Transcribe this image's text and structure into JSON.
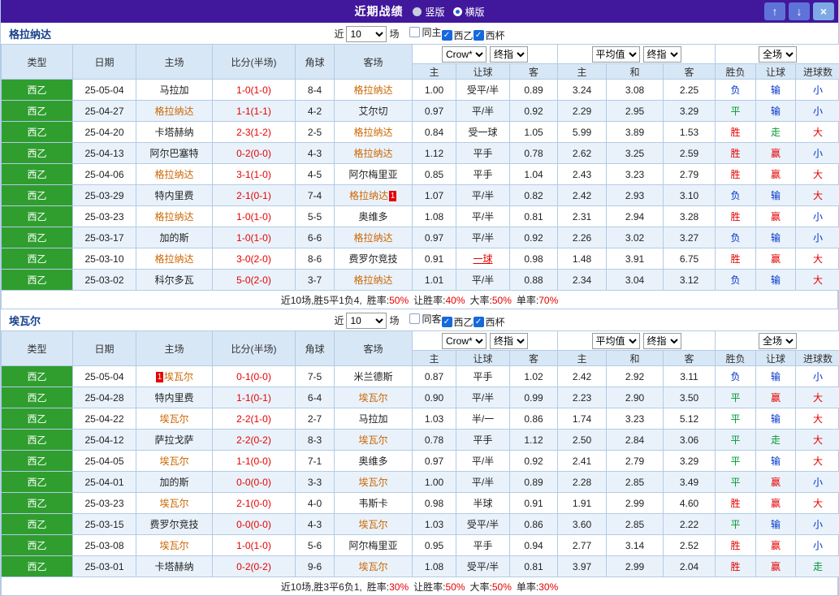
{
  "titlebar": {
    "title": "近期战绩",
    "layout_options": [
      {
        "label": "竖版",
        "selected": false
      },
      {
        "label": "横版",
        "selected": true
      }
    ],
    "up_icon": "↑",
    "down_icon": "↓",
    "close_icon": "×"
  },
  "table_headers": {
    "main": [
      "类型",
      "日期",
      "主场",
      "比分(半场)",
      "角球",
      "客场"
    ],
    "sub": [
      "主",
      "让球",
      "客",
      "主",
      "和",
      "客",
      "胜负",
      "让球",
      "进球数"
    ]
  },
  "colors": {
    "win_red": "#e60000",
    "draw_green": "#009933",
    "loss_blue": "#0033cc",
    "team_highlight": "#cc6600",
    "titlebar_purple": "#41189b",
    "league_green": "#2f9e2f",
    "header_blue": "#d8e7f6"
  },
  "sections": [
    {
      "team": "格拉纳达",
      "filter": {
        "prefix": "近",
        "count": "10",
        "suffix": "场",
        "checkboxes": [
          {
            "label": "同主",
            "checked": false
          },
          {
            "label": "西乙",
            "checked": true
          },
          {
            "label": "西杯",
            "checked": true
          }
        ]
      },
      "selects": {
        "odds_company": "Crow*",
        "odds_stage": "终指",
        "avg_source": "平均值",
        "avg_stage": "终指",
        "scope": "全场"
      },
      "rows": [
        {
          "league": "西乙",
          "date": "25-05-04",
          "home": "马拉加",
          "score": "1-0(1-0)",
          "corners": "8-4",
          "away": "格拉纳达",
          "handicap": [
            "1.00",
            "受平/半",
            "0.89"
          ],
          "average": [
            "3.24",
            "3.08",
            "2.25"
          ],
          "outcome": "负",
          "handicap_result": "输",
          "goals": "小"
        },
        {
          "league": "西乙",
          "date": "25-04-27",
          "home": "格拉纳达",
          "score": "1-1(1-1)",
          "corners": "4-2",
          "away": "艾尔切",
          "handicap": [
            "0.97",
            "平/半",
            "0.92"
          ],
          "average": [
            "2.29",
            "2.95",
            "3.29"
          ],
          "outcome": "平",
          "handicap_result": "输",
          "goals": "小"
        },
        {
          "league": "西乙",
          "date": "25-04-20",
          "home": "卡塔赫纳",
          "score": "2-3(1-2)",
          "corners": "2-5",
          "away": "格拉纳达",
          "handicap": [
            "0.84",
            "受一球",
            "1.05"
          ],
          "average": [
            "5.99",
            "3.89",
            "1.53"
          ],
          "outcome": "胜",
          "handicap_result": "走",
          "goals": "大"
        },
        {
          "league": "西乙",
          "date": "25-04-13",
          "home": "阿尔巴塞特",
          "score": "0-2(0-0)",
          "corners": "4-3",
          "away": "格拉纳达",
          "handicap": [
            "1.12",
            "平手",
            "0.78"
          ],
          "average": [
            "2.62",
            "3.25",
            "2.59"
          ],
          "outcome": "胜",
          "handicap_result": "赢",
          "goals": "小"
        },
        {
          "league": "西乙",
          "date": "25-04-06",
          "home": "格拉纳达",
          "score": "3-1(1-0)",
          "corners": "4-5",
          "away": "阿尔梅里亚",
          "handicap": [
            "0.85",
            "平手",
            "1.04"
          ],
          "average": [
            "2.43",
            "3.23",
            "2.79"
          ],
          "outcome": "胜",
          "handicap_result": "赢",
          "goals": "大"
        },
        {
          "league": "西乙",
          "date": "25-03-29",
          "home": "特内里费",
          "score": "2-1(0-1)",
          "corners": "7-4",
          "away": "格拉纳达",
          "away_badge": "1",
          "away_badge_pos": "after",
          "handicap": [
            "1.07",
            "平/半",
            "0.82"
          ],
          "average": [
            "2.42",
            "2.93",
            "3.10"
          ],
          "outcome": "负",
          "handicap_result": "输",
          "goals": "大"
        },
        {
          "league": "西乙",
          "date": "25-03-23",
          "home": "格拉纳达",
          "score": "1-0(1-0)",
          "corners": "5-5",
          "away": "奥维多",
          "handicap": [
            "1.08",
            "平/半",
            "0.81"
          ],
          "average": [
            "2.31",
            "2.94",
            "3.28"
          ],
          "outcome": "胜",
          "handicap_result": "赢",
          "goals": "小"
        },
        {
          "league": "西乙",
          "date": "25-03-17",
          "home": "加的斯",
          "score": "1-0(1-0)",
          "corners": "6-6",
          "away": "格拉纳达",
          "handicap": [
            "0.97",
            "平/半",
            "0.92"
          ],
          "average": [
            "2.26",
            "3.02",
            "3.27"
          ],
          "outcome": "负",
          "handicap_result": "输",
          "goals": "小"
        },
        {
          "league": "西乙",
          "date": "25-03-10",
          "home": "格拉纳达",
          "score": "3-0(2-0)",
          "corners": "8-6",
          "away": "费罗尔竞技",
          "handicap": [
            "0.91",
            "一球",
            "0.98"
          ],
          "handicap_red": true,
          "average": [
            "1.48",
            "3.91",
            "6.75"
          ],
          "outcome": "胜",
          "handicap_result": "赢",
          "goals": "大"
        },
        {
          "league": "西乙",
          "date": "25-03-02",
          "home": "科尔多瓦",
          "score": "5-0(2-0)",
          "corners": "3-7",
          "away": "格拉纳达",
          "handicap": [
            "1.01",
            "平/半",
            "0.88"
          ],
          "average": [
            "2.34",
            "3.04",
            "3.12"
          ],
          "outcome": "负",
          "handicap_result": "输",
          "goals": "大"
        }
      ],
      "summary": {
        "prefix": "近10场,胜5平1负4,",
        "stats": [
          {
            "label": "胜率:",
            "value": "50%"
          },
          {
            "label": "让胜率:",
            "value": "40%"
          },
          {
            "label": "大率:",
            "value": "50%"
          },
          {
            "label": "单率:",
            "value": "70%"
          }
        ]
      }
    },
    {
      "team": "埃瓦尔",
      "filter": {
        "prefix": "近",
        "count": "10",
        "suffix": "场",
        "checkboxes": [
          {
            "label": "同客",
            "checked": false
          },
          {
            "label": "西乙",
            "checked": true
          },
          {
            "label": "西杯",
            "checked": true
          }
        ]
      },
      "selects": {
        "odds_company": "Crow*",
        "odds_stage": "终指",
        "avg_source": "平均值",
        "avg_stage": "终指",
        "scope": "全场"
      },
      "rows": [
        {
          "league": "西乙",
          "date": "25-05-04",
          "home": "埃瓦尔",
          "home_badge": "1",
          "home_badge_pos": "before",
          "score": "0-1(0-0)",
          "corners": "7-5",
          "away": "米兰德斯",
          "handicap": [
            "0.87",
            "平手",
            "1.02"
          ],
          "average": [
            "2.42",
            "2.92",
            "3.11"
          ],
          "outcome": "负",
          "handicap_result": "输",
          "goals": "小"
        },
        {
          "league": "西乙",
          "date": "25-04-28",
          "home": "特内里费",
          "score": "1-1(0-1)",
          "corners": "6-4",
          "away": "埃瓦尔",
          "handicap": [
            "0.90",
            "平/半",
            "0.99"
          ],
          "average": [
            "2.23",
            "2.90",
            "3.50"
          ],
          "outcome": "平",
          "handicap_result": "赢",
          "goals": "大"
        },
        {
          "league": "西乙",
          "date": "25-04-22",
          "home": "埃瓦尔",
          "score": "2-2(1-0)",
          "corners": "2-7",
          "away": "马拉加",
          "handicap": [
            "1.03",
            "半/一",
            "0.86"
          ],
          "average": [
            "1.74",
            "3.23",
            "5.12"
          ],
          "outcome": "平",
          "handicap_result": "输",
          "goals": "大"
        },
        {
          "league": "西乙",
          "date": "25-04-12",
          "home": "萨拉戈萨",
          "score": "2-2(0-2)",
          "corners": "8-3",
          "away": "埃瓦尔",
          "handicap": [
            "0.78",
            "平手",
            "1.12"
          ],
          "average": [
            "2.50",
            "2.84",
            "3.06"
          ],
          "outcome": "平",
          "handicap_result": "走",
          "goals": "大"
        },
        {
          "league": "西乙",
          "date": "25-04-05",
          "home": "埃瓦尔",
          "score": "1-1(0-0)",
          "corners": "7-1",
          "away": "奥维多",
          "handicap": [
            "0.97",
            "平/半",
            "0.92"
          ],
          "average": [
            "2.41",
            "2.79",
            "3.29"
          ],
          "outcome": "平",
          "handicap_result": "输",
          "goals": "大"
        },
        {
          "league": "西乙",
          "date": "25-04-01",
          "home": "加的斯",
          "score": "0-0(0-0)",
          "corners": "3-3",
          "away": "埃瓦尔",
          "handicap": [
            "1.00",
            "平/半",
            "0.89"
          ],
          "average": [
            "2.28",
            "2.85",
            "3.49"
          ],
          "outcome": "平",
          "handicap_result": "赢",
          "goals": "小"
        },
        {
          "league": "西乙",
          "date": "25-03-23",
          "home": "埃瓦尔",
          "score": "2-1(0-0)",
          "corners": "4-0",
          "away": "韦斯卡",
          "handicap": [
            "0.98",
            "半球",
            "0.91"
          ],
          "average": [
            "1.91",
            "2.99",
            "4.60"
          ],
          "outcome": "胜",
          "handicap_result": "赢",
          "goals": "大"
        },
        {
          "league": "西乙",
          "date": "25-03-15",
          "home": "费罗尔竞技",
          "score": "0-0(0-0)",
          "corners": "4-3",
          "away": "埃瓦尔",
          "handicap": [
            "1.03",
            "受平/半",
            "0.86"
          ],
          "average": [
            "3.60",
            "2.85",
            "2.22"
          ],
          "outcome": "平",
          "handicap_result": "输",
          "goals": "小"
        },
        {
          "league": "西乙",
          "date": "25-03-08",
          "home": "埃瓦尔",
          "score": "1-0(1-0)",
          "corners": "5-6",
          "away": "阿尔梅里亚",
          "handicap": [
            "0.95",
            "平手",
            "0.94"
          ],
          "average": [
            "2.77",
            "3.14",
            "2.52"
          ],
          "outcome": "胜",
          "handicap_result": "赢",
          "goals": "小"
        },
        {
          "league": "西乙",
          "date": "25-03-01",
          "home": "卡塔赫纳",
          "score": "0-2(0-2)",
          "corners": "9-6",
          "away": "埃瓦尔",
          "handicap": [
            "1.08",
            "受平/半",
            "0.81"
          ],
          "average": [
            "3.97",
            "2.99",
            "2.04"
          ],
          "outcome": "胜",
          "handicap_result": "赢",
          "goals": "走"
        }
      ],
      "summary": {
        "prefix": "近10场,胜3平6负1,",
        "stats": [
          {
            "label": "胜率:",
            "value": "30%"
          },
          {
            "label": "让胜率:",
            "value": "50%"
          },
          {
            "label": "大率:",
            "value": "50%"
          },
          {
            "label": "单率:",
            "value": "30%"
          }
        ]
      }
    }
  ]
}
